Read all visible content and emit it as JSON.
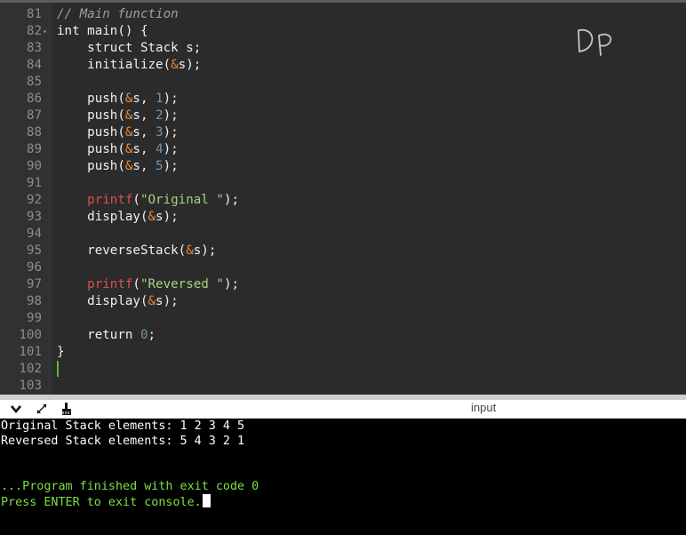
{
  "editor": {
    "lines": [
      {
        "n": "81",
        "code": [
          {
            "t": "// Main function",
            "c": "cm"
          }
        ]
      },
      {
        "n": "82",
        "fold": true,
        "code": [
          {
            "t": "int main() {"
          }
        ]
      },
      {
        "n": "83",
        "code": [
          {
            "t": "    struct Stack s;"
          }
        ]
      },
      {
        "n": "84",
        "code": [
          {
            "t": "    initialize("
          },
          {
            "t": "&",
            "c": "amp"
          },
          {
            "t": "s);"
          }
        ]
      },
      {
        "n": "85",
        "code": []
      },
      {
        "n": "86",
        "code": [
          {
            "t": "    push("
          },
          {
            "t": "&",
            "c": "amp"
          },
          {
            "t": "s, "
          },
          {
            "t": "1",
            "c": "num"
          },
          {
            "t": ");"
          }
        ]
      },
      {
        "n": "87",
        "code": [
          {
            "t": "    push("
          },
          {
            "t": "&",
            "c": "amp"
          },
          {
            "t": "s, "
          },
          {
            "t": "2",
            "c": "num"
          },
          {
            "t": ");"
          }
        ]
      },
      {
        "n": "88",
        "code": [
          {
            "t": "    push("
          },
          {
            "t": "&",
            "c": "amp"
          },
          {
            "t": "s, "
          },
          {
            "t": "3",
            "c": "num"
          },
          {
            "t": ");"
          }
        ]
      },
      {
        "n": "89",
        "code": [
          {
            "t": "    push("
          },
          {
            "t": "&",
            "c": "amp"
          },
          {
            "t": "s, "
          },
          {
            "t": "4",
            "c": "num"
          },
          {
            "t": ");"
          }
        ]
      },
      {
        "n": "90",
        "code": [
          {
            "t": "    push("
          },
          {
            "t": "&",
            "c": "amp"
          },
          {
            "t": "s, "
          },
          {
            "t": "5",
            "c": "num"
          },
          {
            "t": ");"
          }
        ]
      },
      {
        "n": "91",
        "code": []
      },
      {
        "n": "92",
        "code": [
          {
            "t": "    "
          },
          {
            "t": "printf",
            "c": "fn"
          },
          {
            "t": "("
          },
          {
            "t": "\"Original \"",
            "c": "str"
          },
          {
            "t": ");"
          }
        ]
      },
      {
        "n": "93",
        "code": [
          {
            "t": "    display("
          },
          {
            "t": "&",
            "c": "amp"
          },
          {
            "t": "s);"
          }
        ]
      },
      {
        "n": "94",
        "code": []
      },
      {
        "n": "95",
        "code": [
          {
            "t": "    reverseStack("
          },
          {
            "t": "&",
            "c": "amp"
          },
          {
            "t": "s);"
          }
        ]
      },
      {
        "n": "96",
        "code": []
      },
      {
        "n": "97",
        "code": [
          {
            "t": "    "
          },
          {
            "t": "printf",
            "c": "fn"
          },
          {
            "t": "("
          },
          {
            "t": "\"Reversed \"",
            "c": "str"
          },
          {
            "t": ");"
          }
        ]
      },
      {
        "n": "98",
        "code": [
          {
            "t": "    display("
          },
          {
            "t": "&",
            "c": "amp"
          },
          {
            "t": "s);"
          }
        ]
      },
      {
        "n": "99",
        "code": []
      },
      {
        "n": "100",
        "code": [
          {
            "t": "    return "
          },
          {
            "t": "0",
            "c": "num"
          },
          {
            "t": ";"
          }
        ]
      },
      {
        "n": "101",
        "code": [
          {
            "t": "}"
          }
        ]
      },
      {
        "n": "102",
        "code": []
      },
      {
        "n": "103",
        "code": []
      }
    ],
    "watermark": "DP"
  },
  "toolbar": {
    "input_label": "input",
    "icons": [
      "chevron-down-icon",
      "expand-arrows-icon",
      "clear-console-icon"
    ]
  },
  "console": {
    "output": [
      "Original Stack elements: 1 2 3 4 5",
      "Reversed Stack elements: 5 4 3 2 1"
    ],
    "status": [
      "...Program finished with exit code 0",
      "Press ENTER to exit console."
    ]
  },
  "colors": {
    "editor_bg": "#2b2b2b",
    "comment": "#9aa0a6",
    "ampersand": "#e8893c",
    "number": "#6897bb",
    "function": "#d8524e",
    "string": "#a4d47e",
    "console_green": "#7ce043"
  }
}
